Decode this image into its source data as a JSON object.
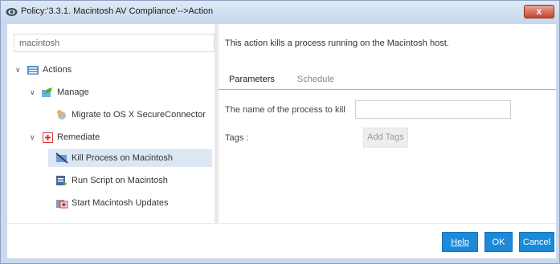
{
  "window": {
    "title": "Policy:'3.3.1. Macintosh AV Compliance'-->Action",
    "close_label": "x"
  },
  "left_panel": {
    "search_value": "macintosh",
    "tree": {
      "actions_label": "Actions",
      "manage_label": "Manage",
      "migrate_label": "Migrate to OS X SecureConnector",
      "remediate_label": "Remediate",
      "remediate_items": [
        {
          "label": "Kill Process on Macintosh",
          "icon": "kill-process-icon",
          "selected": true
        },
        {
          "label": "Run Script on Macintosh",
          "icon": "script-icon",
          "selected": false
        },
        {
          "label": "Start Macintosh Updates",
          "icon": "updates-icon",
          "selected": false
        }
      ]
    }
  },
  "right_panel": {
    "description": "This action kills a process running on the Macintosh host.",
    "tabs": [
      {
        "label": "Parameters",
        "active": true
      },
      {
        "label": "Schedule",
        "active": false
      }
    ],
    "process_name_label": "The name of the process to kill",
    "process_name_value": "",
    "tags_label": "Tags :",
    "add_tags_label": "Add Tags"
  },
  "footer": {
    "help_label": "Help",
    "ok_label": "OK",
    "cancel_label": "Cancel"
  },
  "colors": {
    "accent": "#1b8ad8",
    "selection": "#dbe7f3",
    "close": "#c4442e"
  }
}
